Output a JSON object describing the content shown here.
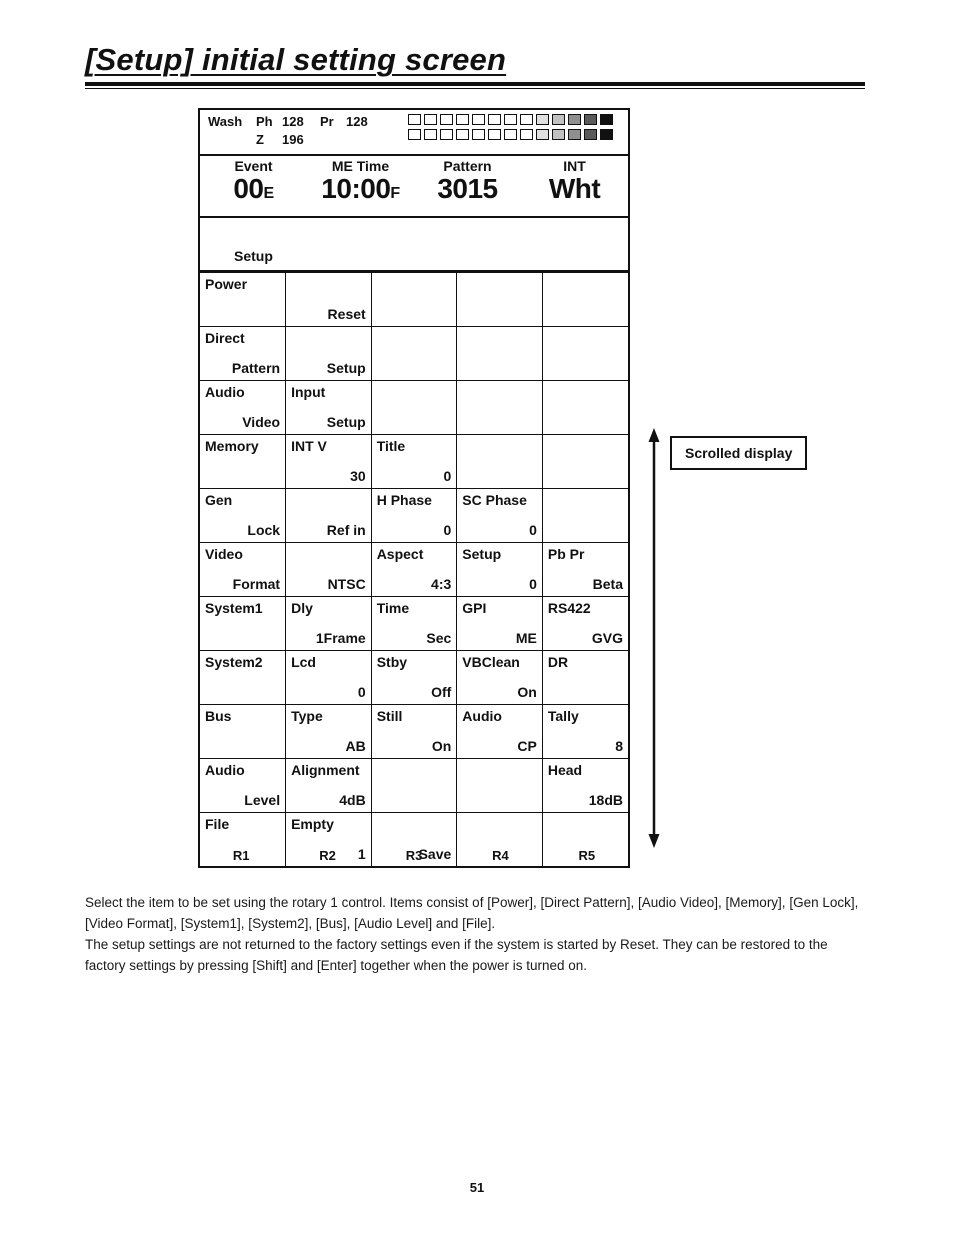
{
  "page": {
    "title": "[Setup] initial setting screen",
    "number": "51"
  },
  "lcd": {
    "status": {
      "wash": "Wash",
      "ph_label": "Ph",
      "ph_value": "128",
      "pr_label": "Pr",
      "pr_value": "128",
      "z_label": "Z",
      "z_value": "196",
      "bar_rows": [
        [
          "#ffffff",
          "#ffffff",
          "#ffffff",
          "#ffffff",
          "#ffffff",
          "#ffffff",
          "#ffffff",
          "#ffffff",
          "#e0e0e0",
          "#c0c0c0",
          "#8f8f8f",
          "#5a5a5a",
          "#111111"
        ],
        [
          "#ffffff",
          "#ffffff",
          "#ffffff",
          "#ffffff",
          "#ffffff",
          "#ffffff",
          "#ffffff",
          "#ffffff",
          "#e0e0e0",
          "#c0c0c0",
          "#8f8f8f",
          "#5a5a5a",
          "#111111"
        ]
      ]
    },
    "readouts": [
      {
        "label": "Event",
        "value": "00",
        "suffix": "E"
      },
      {
        "label": "ME Time",
        "value": "10:00",
        "suffix": "F"
      },
      {
        "label": "Pattern",
        "value": "3015",
        "suffix": ""
      },
      {
        "label": "INT",
        "value": "Wht",
        "suffix": ""
      }
    ],
    "setup_heading": "Setup",
    "rows": [
      {
        "name": "power",
        "cells": [
          {
            "top": "Power",
            "bottom": ""
          },
          {
            "top": "",
            "bottom": "Reset"
          },
          {
            "top": "",
            "bottom": ""
          },
          {
            "top": "",
            "bottom": ""
          },
          {
            "top": "",
            "bottom": ""
          }
        ]
      },
      {
        "name": "direct-pattern",
        "cells": [
          {
            "top": "Direct",
            "bottom": "Pattern"
          },
          {
            "top": "",
            "bottom": "Setup"
          },
          {
            "top": "",
            "bottom": ""
          },
          {
            "top": "",
            "bottom": ""
          },
          {
            "top": "",
            "bottom": ""
          }
        ]
      },
      {
        "name": "audio-video",
        "cells": [
          {
            "top": "Audio",
            "bottom": "Video"
          },
          {
            "top": "Input",
            "bottom": "Setup"
          },
          {
            "top": "",
            "bottom": ""
          },
          {
            "top": "",
            "bottom": ""
          },
          {
            "top": "",
            "bottom": ""
          }
        ]
      },
      {
        "name": "memory",
        "cells": [
          {
            "top": "Memory",
            "bottom": ""
          },
          {
            "top": "INT V",
            "bottom": "30"
          },
          {
            "top": "Title",
            "bottom": "0"
          },
          {
            "top": "",
            "bottom": ""
          },
          {
            "top": "",
            "bottom": ""
          }
        ]
      },
      {
        "name": "gen-lock",
        "cells": [
          {
            "top": "Gen",
            "bottom": "Lock"
          },
          {
            "top": "",
            "bottom": "Ref in"
          },
          {
            "top": "H Phase",
            "bottom": "0"
          },
          {
            "top": "SC Phase",
            "bottom": "0"
          },
          {
            "top": "",
            "bottom": ""
          }
        ]
      },
      {
        "name": "video-format",
        "cells": [
          {
            "top": "Video",
            "bottom": "Format"
          },
          {
            "top": "",
            "bottom": "NTSC"
          },
          {
            "top": "Aspect",
            "bottom": "4:3"
          },
          {
            "top": "Setup",
            "bottom": "0"
          },
          {
            "top": "Pb Pr",
            "bottom": "Beta"
          }
        ]
      },
      {
        "name": "system1",
        "cells": [
          {
            "top": "System1",
            "bottom": ""
          },
          {
            "top": "Dly",
            "bottom": "1Frame"
          },
          {
            "top": "Time",
            "bottom": "Sec"
          },
          {
            "top": "GPI",
            "bottom": "ME"
          },
          {
            "top": "RS422",
            "bottom": "GVG"
          }
        ]
      },
      {
        "name": "system2",
        "cells": [
          {
            "top": "System2",
            "bottom": ""
          },
          {
            "top": "Lcd",
            "bottom": "0"
          },
          {
            "top": "Stby",
            "bottom": "Off"
          },
          {
            "top": "VBClean",
            "bottom": "On"
          },
          {
            "top": "DR",
            "bottom": ""
          }
        ]
      },
      {
        "name": "bus",
        "cells": [
          {
            "top": "Bus",
            "bottom": ""
          },
          {
            "top": "Type",
            "bottom": "AB"
          },
          {
            "top": "Still",
            "bottom": "On"
          },
          {
            "top": "Audio",
            "bottom": "CP"
          },
          {
            "top": "Tally",
            "bottom": "8"
          }
        ]
      },
      {
        "name": "audio-level",
        "cells": [
          {
            "top": "Audio",
            "bottom": "Level"
          },
          {
            "top": "Alignment",
            "bottom": "4dB"
          },
          {
            "top": "",
            "bottom": ""
          },
          {
            "top": "",
            "bottom": ""
          },
          {
            "top": "Head",
            "bottom": "18dB"
          }
        ]
      },
      {
        "name": "file",
        "cells": [
          {
            "top": "File",
            "bottom": ""
          },
          {
            "top": "Empty",
            "bottom": "1"
          },
          {
            "top": "",
            "bottom": "Save"
          },
          {
            "top": "",
            "bottom": ""
          },
          {
            "top": "",
            "bottom": ""
          }
        ]
      }
    ],
    "rotary_labels": [
      "R1",
      "R2",
      "R3",
      "R4",
      "R5"
    ]
  },
  "annotation": {
    "scrolled_display": "Scrolled display"
  },
  "body": {
    "paragraph1": "Select the item to be set using the rotary 1 control.  Items consist of [Power], [Direct Pattern], [Audio Video], [Memory], [Gen Lock], [Video Format], [System1], [System2], [Bus], [Audio Level] and [File].",
    "paragraph2": "The setup settings are not returned to the factory settings even if the system is started by Reset.  They can be restored to the factory settings by pressing [Shift] and [Enter] together when the power is turned on."
  }
}
